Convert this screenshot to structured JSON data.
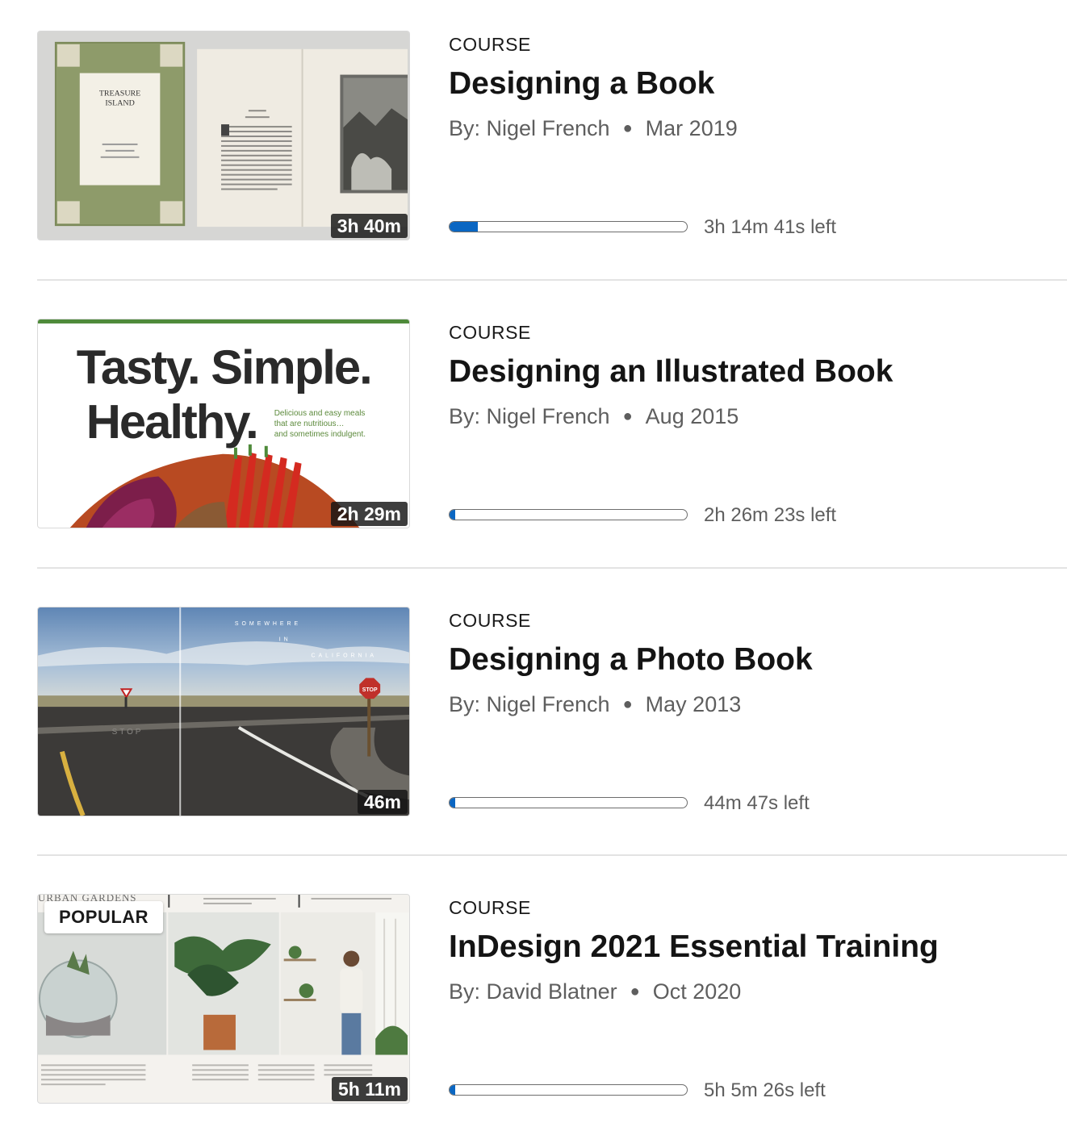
{
  "courses": [
    {
      "type": "COURSE",
      "title": "Designing a Book",
      "author": "By: Nigel French",
      "date": "Mar 2019",
      "duration": "3h 40m",
      "progress": 0.12,
      "time_left": "3h 14m 41s left",
      "thumbnail": {
        "cover_title_line1": "TREASURE",
        "cover_title_line2": "ISLAND"
      }
    },
    {
      "type": "COURSE",
      "title": "Designing an Illustrated Book",
      "author": "By: Nigel French",
      "date": "Aug 2015",
      "duration": "2h 29m",
      "progress": 0.025,
      "time_left": "2h 26m 23s left",
      "thumbnail": {
        "headline_line1": "Tasty. Simple.",
        "headline_line2": "Healthy.",
        "tagline_line1": "Delicious and easy meals",
        "tagline_line2": "that are nutritious…",
        "tagline_line3": "and sometimes indulgent."
      }
    },
    {
      "type": "COURSE",
      "title": "Designing a Photo Book",
      "author": "By: Nigel French",
      "date": "May 2013",
      "duration": "46m",
      "progress": 0.025,
      "time_left": "44m 47s left",
      "thumbnail": {
        "overlay_line1": "SOMEWHERE",
        "overlay_line2": "IN",
        "overlay_line3": "CALIFORNIA",
        "sign_text": "STOP",
        "road_text": "STOP"
      }
    },
    {
      "type": "COURSE",
      "title": "InDesign 2021 Essential Training",
      "author": "By: David Blatner",
      "date": "Oct 2020",
      "duration": "5h 11m",
      "progress": 0.025,
      "time_left": "5h 5m 26s left",
      "badge": "POPULAR",
      "thumbnail": {
        "header_text": "URBAN GARDENS"
      }
    }
  ],
  "colors": {
    "progress_fill": "#0a66c2",
    "divider": "#e3e3e3",
    "meta_text": "#5e5e5e"
  }
}
